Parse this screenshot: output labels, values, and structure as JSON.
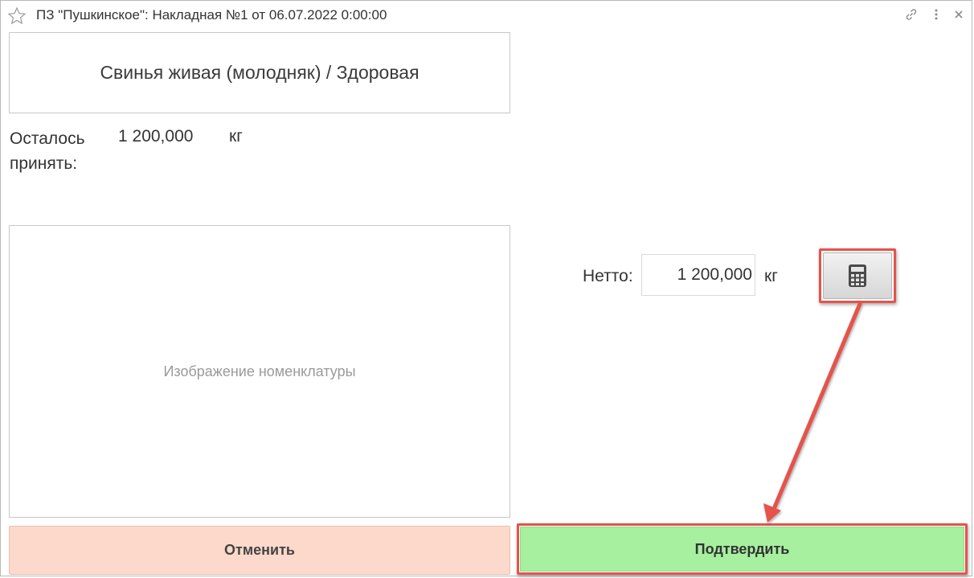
{
  "window": {
    "title": "ПЗ \"Пушкинское\": Накладная №1 от 06.07.2022 0:00:00"
  },
  "titlebar_icons": [
    "star-icon",
    "link-icon",
    "more-icon",
    "close-icon"
  ],
  "product": {
    "name": "Свинья живая (молодняк) / Здоровая"
  },
  "remaining": {
    "label": "Осталось принять:",
    "value": "1 200,000",
    "unit": "кг"
  },
  "image_placeholder": "Изображение номенклатуры",
  "netto": {
    "label": "Нетто:",
    "value": "1 200,000",
    "unit": "кг"
  },
  "calculator_icon": "calculator-icon",
  "buttons": {
    "cancel": "Отменить",
    "confirm": "Подтвердить"
  },
  "colors": {
    "cancel_bg": "#fdd9cc",
    "confirm_bg": "#a6f0a0",
    "highlight": "#e5534b"
  }
}
